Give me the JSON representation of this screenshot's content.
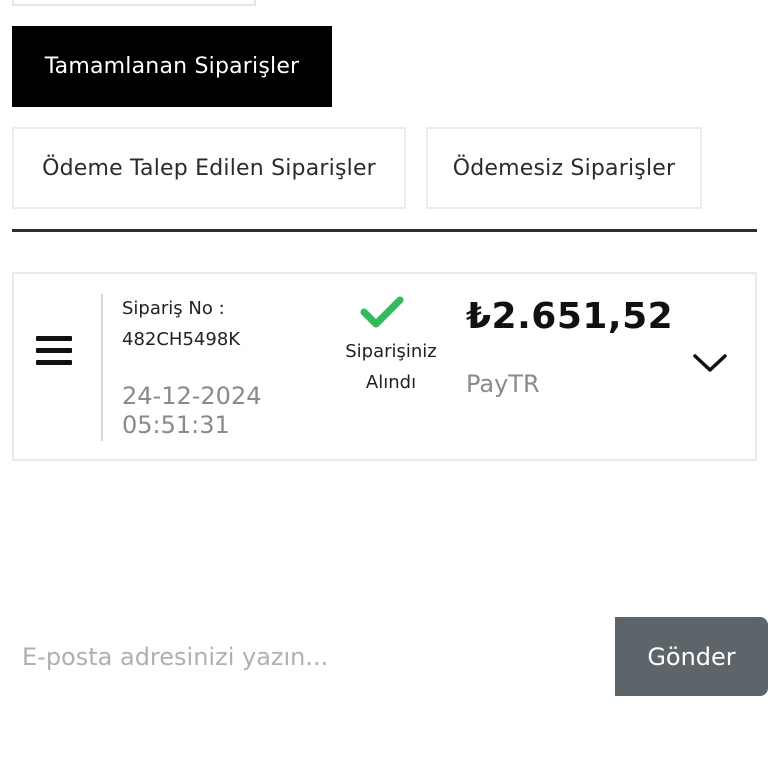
{
  "tabs": {
    "completed": "Tamamlanan Siparişler",
    "payment_requested": "Ödeme Talep Edilen Siparişler",
    "unpaid": "Ödemesiz Siparişler"
  },
  "order": {
    "number_label": "Sipariş No :",
    "number_value": "482CH5498K",
    "date": "24-12-2024",
    "time": "05:51:31",
    "status_line1": "Siparişiniz",
    "status_line2": "Alındı",
    "amount": "₺2.651,52",
    "payment_method": "PayTR",
    "status_color": "#2ebd59"
  },
  "newsletter": {
    "placeholder": "E-posta adresinizi yazın...",
    "submit_label": "Gönder"
  },
  "icons": [
    "menu-icon",
    "check-icon",
    "chevron-down-icon"
  ]
}
